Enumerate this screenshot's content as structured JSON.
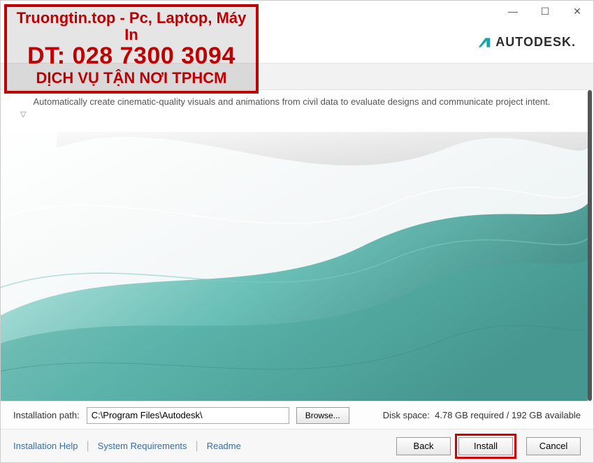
{
  "titlebar": {
    "minimize": "—",
    "maximize": "☐",
    "close": "✕"
  },
  "brand": {
    "name": "AUTODESK",
    "dot": "."
  },
  "product": {
    "description": "Automatically create cinematic-quality visuals and animations from civil data to evaluate designs and communicate project intent."
  },
  "install_path": {
    "label": "Installation path:",
    "value": "C:\\Program Files\\Autodesk\\",
    "browse": "Browse..."
  },
  "disk": {
    "label": "Disk space:",
    "required": "4.78 GB required",
    "available": "192 GB available"
  },
  "footer_links": {
    "help": "Installation Help",
    "req": "System Requirements",
    "readme": "Readme"
  },
  "buttons": {
    "back": "Back",
    "install": "Install",
    "cancel": "Cancel"
  },
  "watermark": {
    "line1": "Truongtin.top - Pc, Laptop, Máy In",
    "line2": "DT: 028 7300 3094",
    "line3": "DỊCH VỤ TẬN NƠI TPHCM"
  }
}
